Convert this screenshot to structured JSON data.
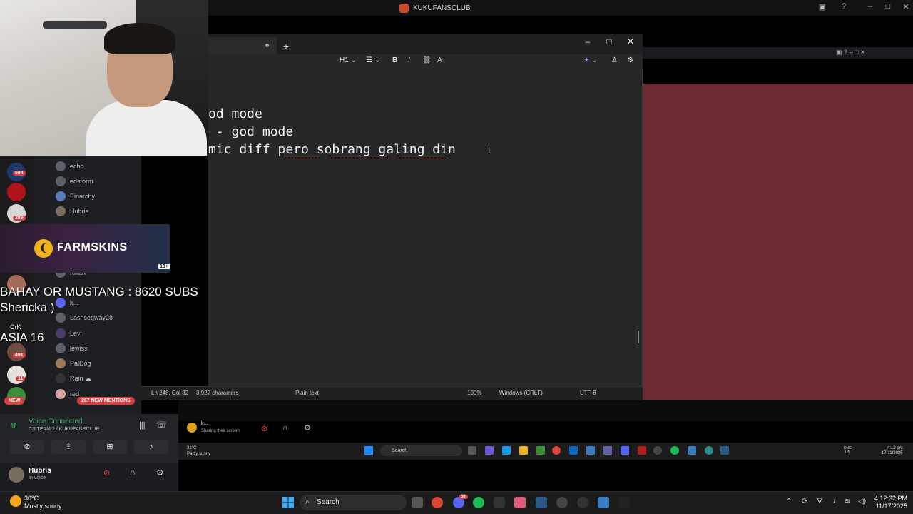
{
  "discord": {
    "server_title": "KUKUFANSCLUB",
    "members": [
      "echo",
      "edstorm",
      "Einarchy",
      "Hubris",
      "Killan",
      "k...",
      "Lashsegway28",
      "Levi",
      "lewiss",
      "PalDog",
      "Rain ☁",
      "red"
    ],
    "server_badges": [
      "584",
      "289",
      "1.49",
      "491",
      "11"
    ],
    "new_label": "NEW",
    "mentions_label": "267 NEW MENTIONS",
    "voice": {
      "status": "Voice Connected",
      "channel": "CS TEAM 2 / KUKUFANSCLUB"
    },
    "user": {
      "name": "Hubris",
      "status": "In voice"
    },
    "sharing_user": "k...",
    "sharing_status": "Sharing their screen"
  },
  "ad": {
    "brand": "FARMSKINS",
    "age": "18+"
  },
  "overlay": {
    "line1": "BAHAY OR MUSTANG : 8620 SUBS",
    "line2": "Shericka )",
    "line3": "CrK",
    "line4": "ASIA 16"
  },
  "notepad": {
    "heading_label": "H1",
    "lines": [
      "od mode",
      " - god mode",
      "mic diff pero sobrang galing din"
    ],
    "status": {
      "position": "Ln 248, Col 32",
      "chars": "3,927 characters",
      "format": "Plain text",
      "zoom": "100%",
      "line_ending": "Windows (CRLF)",
      "encoding": "UTF-8"
    }
  },
  "inner_taskbar": {
    "weather_temp": "31°C",
    "weather_desc": "Partly sunny",
    "search": "Search",
    "lang1": "ENG",
    "lang2": "US",
    "time": "4:12 pm",
    "date": "17/11/2025"
  },
  "taskbar": {
    "weather_temp": "30°C",
    "weather_desc": "Mostly sunny",
    "search": "Search",
    "time": "4:12:32 PM",
    "date": "11/17/2025",
    "discord_badge": "56"
  }
}
